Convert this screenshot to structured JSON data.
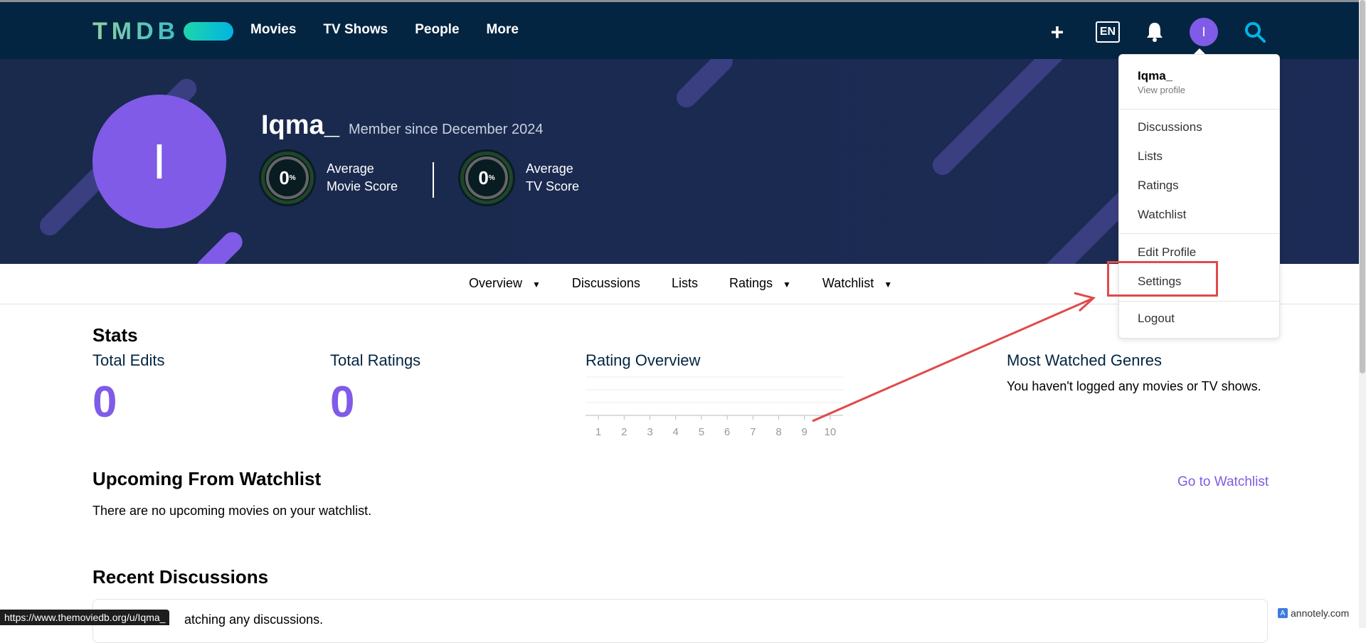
{
  "header": {
    "logo": "TMDB",
    "nav": [
      "Movies",
      "TV Shows",
      "People",
      "More"
    ],
    "lang": "EN",
    "avatar_initial": "I"
  },
  "profile": {
    "avatar_initial": "I",
    "username": "Iqma_",
    "member_since": "Member since December 2024",
    "scores": [
      {
        "value": "0",
        "unit": "%",
        "label_line1": "Average",
        "label_line2": "Movie Score"
      },
      {
        "value": "0",
        "unit": "%",
        "label_line1": "Average",
        "label_line2": "TV Score"
      }
    ]
  },
  "subnav": {
    "items": [
      "Overview",
      "Discussions",
      "Lists",
      "Ratings",
      "Watchlist"
    ]
  },
  "stats": {
    "title": "Stats",
    "total_edits_label": "Total Edits",
    "total_edits_value": "0",
    "total_ratings_label": "Total Ratings",
    "total_ratings_value": "0",
    "rating_overview_label": "Rating Overview",
    "rating_ticks": [
      "1",
      "2",
      "3",
      "4",
      "5",
      "6",
      "7",
      "8",
      "9",
      "10"
    ],
    "genres_label": "Most Watched Genres",
    "genres_text": "You haven't logged any movies or TV shows."
  },
  "watchlist": {
    "title": "Upcoming From Watchlist",
    "text": "There are no upcoming movies on your watchlist.",
    "link": "Go to Watchlist"
  },
  "discussions": {
    "title": "Recent Discussions",
    "text": "atching any discussions."
  },
  "dropdown": {
    "username": "Iqma_",
    "view_profile": "View profile",
    "items_group1": [
      "Discussions",
      "Lists",
      "Ratings",
      "Watchlist"
    ],
    "edit_profile": "Edit Profile",
    "settings": "Settings",
    "logout": "Logout"
  },
  "status_bar": {
    "url": "https://www.themoviedb.org/u/Iqma_"
  },
  "watermark": {
    "text": "annotely.com"
  },
  "colors": {
    "header_bg": "#032541",
    "accent_purple": "#805be7",
    "annotation_red": "#e04a4a"
  }
}
